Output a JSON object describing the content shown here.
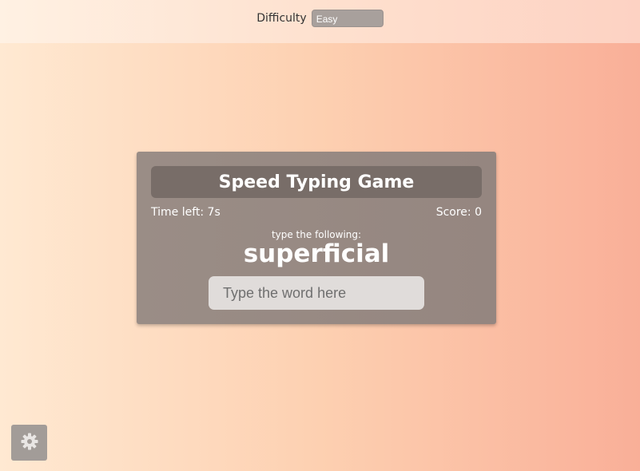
{
  "difficulty": {
    "label": "Difficulty",
    "selected": "Easy"
  },
  "game": {
    "title": "Speed Typing Game",
    "time_left": "Time left: 7s",
    "score": "Score: 0",
    "prompt": "type the following:",
    "word": "superficial",
    "input_placeholder": "Type the word here",
    "input_value": ""
  },
  "settings": {
    "icon": "gear-icon"
  },
  "colors": {
    "card_bg": "#968881",
    "title_bg": "#786d68",
    "select_bg": "#a8a09c",
    "settings_bg": "#a29c98",
    "input_bg": "#e0dcda"
  }
}
